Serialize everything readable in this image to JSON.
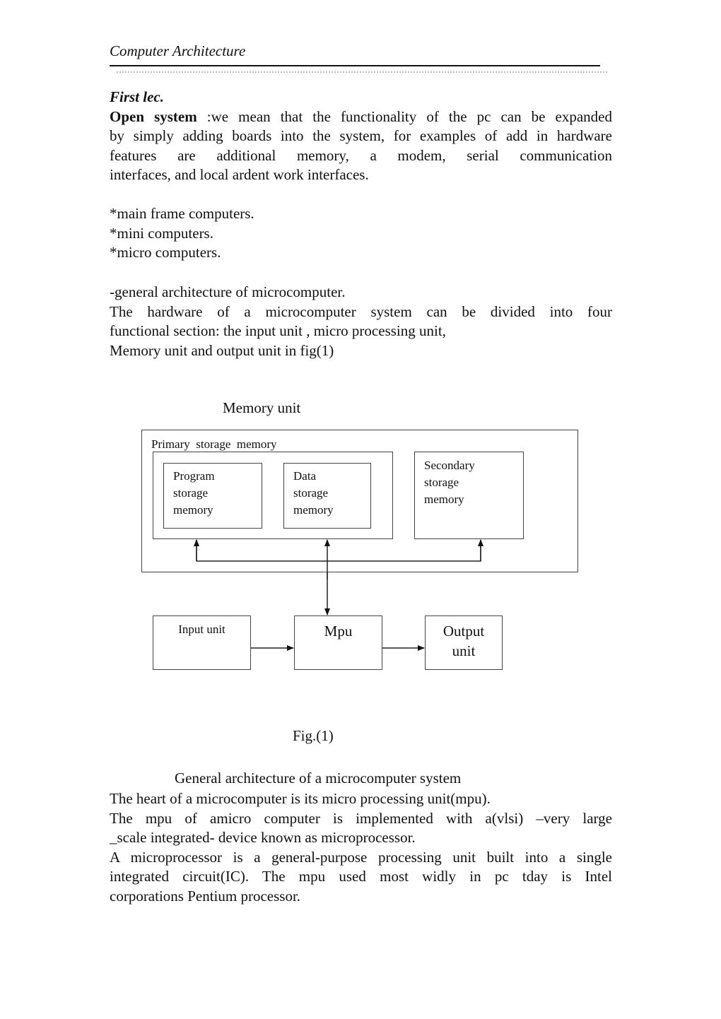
{
  "header": {
    "title": "Computer Architecture"
  },
  "lecture": {
    "label": "First lec.",
    "open_system_term": "Open system",
    "open_system_lines": [
      " :we mean that the functionality of the pc can be expanded",
      "by simply adding boards into the system, for examples of add in hardware",
      "features are additional memory, a modem, serial communication",
      "interfaces, and local ardent work interfaces."
    ],
    "computer_types": [
      "*main frame computers.",
      "*mini computers.",
      "*micro computers."
    ],
    "arch_heading": "-general architecture of microcomputer.",
    "arch_lines": [
      "The hardware of a microcomputer system can be divided into four",
      "functional section: the input unit , micro processing unit,",
      "Memory unit and output unit in fig(1)"
    ]
  },
  "diagram": {
    "memory_unit_label": "Memory unit",
    "primary_label": "Primary  storage  memory",
    "program_box": [
      "Program",
      "storage",
      "memory"
    ],
    "data_box": [
      "Data",
      "storage",
      "memory"
    ],
    "secondary_box": [
      "Secondary",
      "storage",
      "memory"
    ],
    "input_unit": "Input unit",
    "mpu": "Mpu",
    "output_unit": [
      "Output",
      "unit"
    ],
    "fig_label": "Fig.(1)",
    "caption": "General architecture of a microcomputer system"
  },
  "closing": {
    "lines": [
      "The heart of a microcomputer is its micro processing unit(mpu).",
      "The mpu of amicro computer is implemented with a(vlsi) –very large",
      "_scale integrated- device known as microprocessor.",
      "A microprocessor is a general-purpose processing unit built into a single",
      "integrated circuit(IC). The mpu used most widly in pc tday is Intel",
      "corporations Pentium processor."
    ]
  }
}
